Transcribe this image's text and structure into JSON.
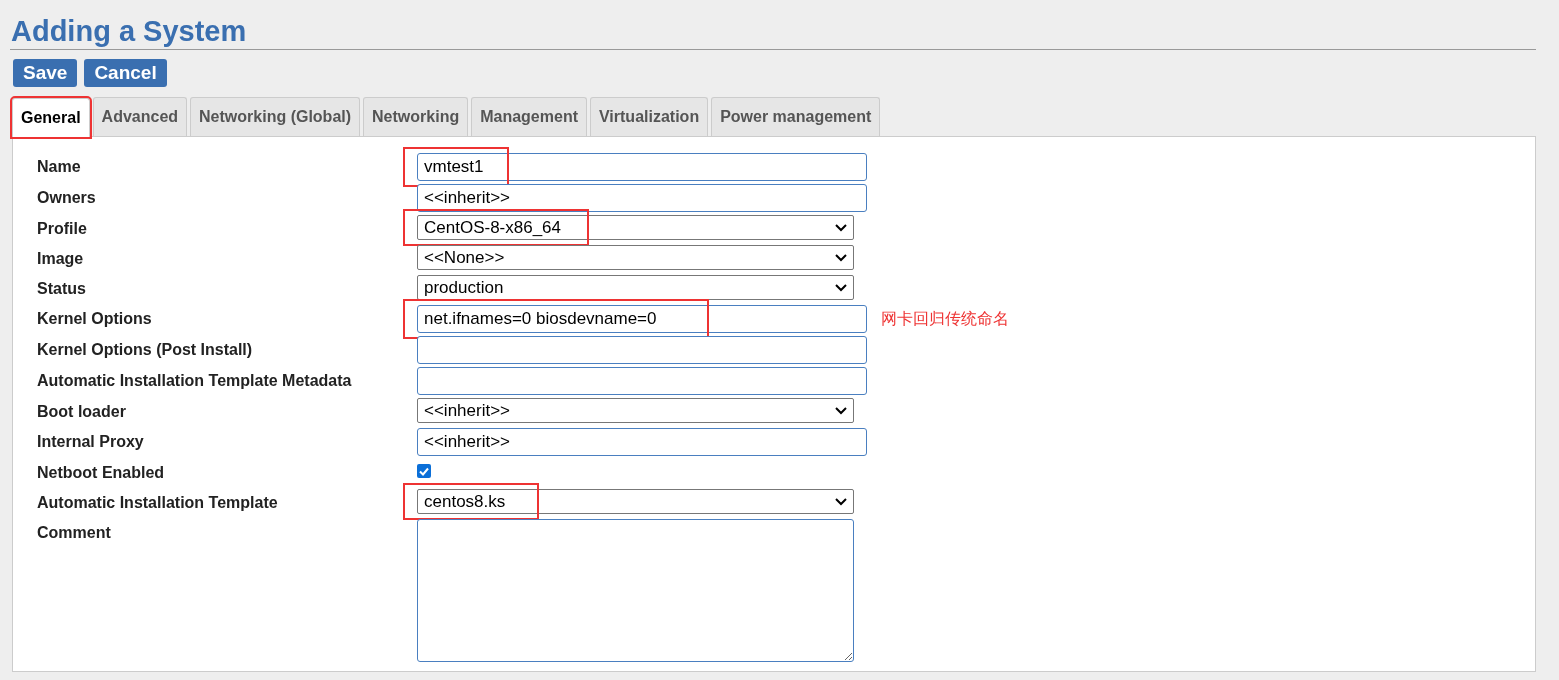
{
  "page": {
    "title": "Adding a System"
  },
  "buttons": [
    "Save",
    "Cancel"
  ],
  "tabs": [
    {
      "label": "General",
      "selected": true,
      "highlighted": true
    },
    {
      "label": "Advanced",
      "selected": false,
      "highlighted": false
    },
    {
      "label": "Networking (Global)",
      "selected": false,
      "highlighted": false
    },
    {
      "label": "Networking",
      "selected": false,
      "highlighted": false
    },
    {
      "label": "Management",
      "selected": false,
      "highlighted": false
    },
    {
      "label": "Virtualization",
      "selected": false,
      "highlighted": false
    },
    {
      "label": "Power management",
      "selected": false,
      "highlighted": false
    }
  ],
  "fields": [
    {
      "label": "Name",
      "kind": "text",
      "value": "vmtest1",
      "highlighted": true
    },
    {
      "label": "Owners",
      "kind": "text",
      "value": "<<inherit>>",
      "highlighted": false
    },
    {
      "label": "Profile",
      "kind": "select",
      "value": "CentOS-8-x86_64",
      "highlighted": true
    },
    {
      "label": "Image",
      "kind": "select",
      "value": "<<None>>",
      "highlighted": false
    },
    {
      "label": "Status",
      "kind": "select",
      "value": "production",
      "highlighted": false
    },
    {
      "label": "Kernel Options",
      "kind": "text",
      "value": "net.ifnames=0 biosdevname=0",
      "highlighted": true,
      "note": "网卡回归传统命名"
    },
    {
      "label": "Kernel Options (Post Install)",
      "kind": "text",
      "highlighted": false
    },
    {
      "label": "Automatic Installation Template Metadata",
      "kind": "text",
      "highlighted": false
    },
    {
      "label": "Boot loader",
      "kind": "select",
      "value": "<<inherit>>",
      "highlighted": false
    },
    {
      "label": "Internal Proxy",
      "kind": "text",
      "value": "<<inherit>>",
      "highlighted": false
    },
    {
      "label": "Netboot Enabled",
      "kind": "checkbox",
      "checked": true,
      "highlighted": false
    },
    {
      "label": "Automatic Installation Template",
      "kind": "select",
      "value": "centos8.ks",
      "highlighted": true
    },
    {
      "label": "Comment",
      "kind": "textarea",
      "highlighted": false
    }
  ]
}
